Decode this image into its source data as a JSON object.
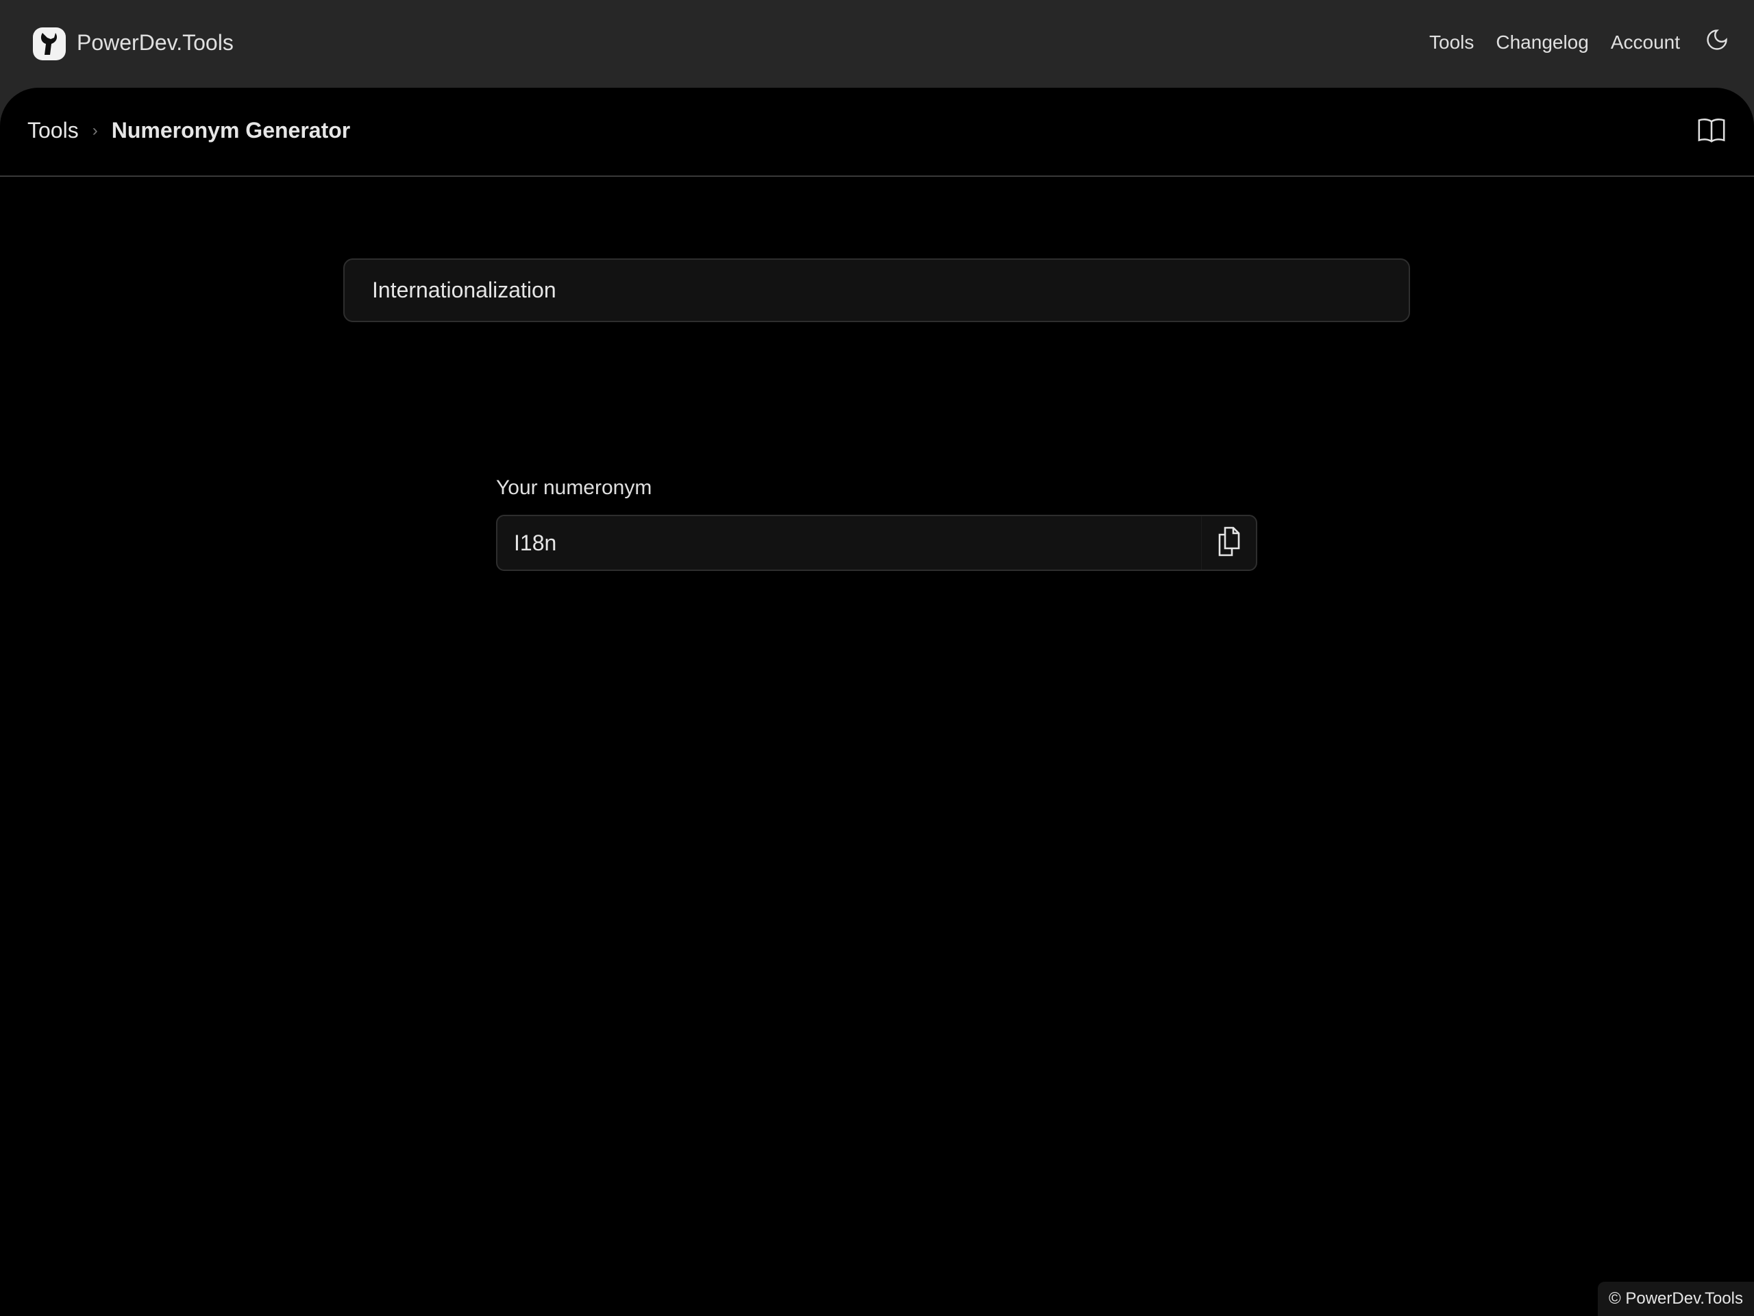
{
  "header": {
    "brand": "PowerDev.Tools",
    "nav": [
      "Tools",
      "Changelog",
      "Account"
    ],
    "theme_icon": "moon-icon"
  },
  "breadcrumb": {
    "parent": "Tools",
    "current": "Numeronym Generator"
  },
  "input": {
    "value": "Internationalization"
  },
  "output": {
    "label": "Your numeronym",
    "value": "I18n",
    "copy_icon": "copy-icon"
  },
  "footer": {
    "text": "© PowerDev.Tools"
  }
}
